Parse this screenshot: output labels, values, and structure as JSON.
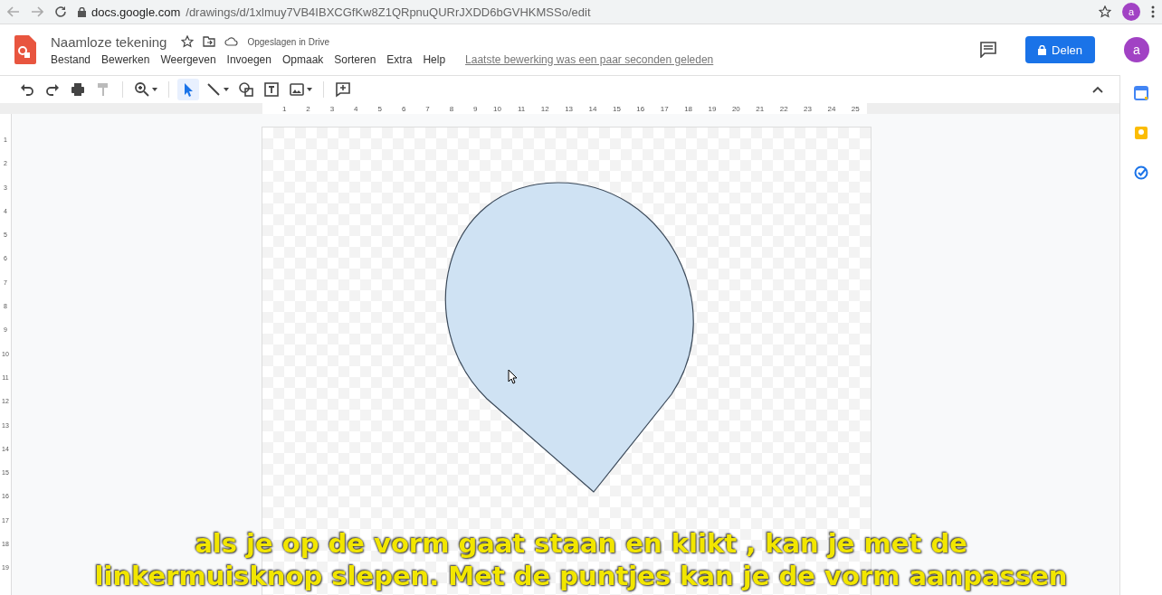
{
  "browser": {
    "url_host": "docs.google.com",
    "url_path": "/drawings/d/1xlmuy7VB4IBXCGfKw8Z1QRpnuQURrJXDD6bGVHKMSSo/edit",
    "avatar": "a"
  },
  "app": {
    "title": "Naamloze tekening",
    "save_status": "Opgeslagen in Drive",
    "menu": [
      "Bestand",
      "Bewerken",
      "Weergeven",
      "Invoegen",
      "Opmaak",
      "Sorteren",
      "Extra",
      "Help"
    ],
    "last_edit": "Laatste bewerking was een paar seconden geleden",
    "share_button": "Delen",
    "avatar": "a"
  },
  "toolbar": {
    "tools": [
      {
        "kind": "undo",
        "selected": false
      },
      {
        "kind": "redo",
        "selected": false
      },
      {
        "kind": "print",
        "selected": false
      },
      {
        "kind": "paint",
        "selected": false
      },
      {
        "kind": "zoom",
        "selected": false
      },
      {
        "kind": "select",
        "selected": true
      },
      {
        "kind": "line",
        "selected": false
      },
      {
        "kind": "shape",
        "selected": false
      },
      {
        "kind": "textbox",
        "selected": false
      },
      {
        "kind": "image",
        "selected": false
      },
      {
        "kind": "comment",
        "selected": false
      }
    ]
  },
  "rulers": {
    "horizontal": [
      "1",
      "2",
      "3",
      "4",
      "5",
      "6",
      "7",
      "8",
      "9",
      "10",
      "11",
      "12",
      "13",
      "14",
      "15",
      "16",
      "17",
      "18",
      "19",
      "20",
      "21",
      "22",
      "23",
      "24",
      "25"
    ],
    "vertical": [
      "1",
      "2",
      "3",
      "4",
      "5",
      "6",
      "7",
      "8",
      "9",
      "10",
      "11",
      "12",
      "13",
      "14",
      "15",
      "16",
      "17",
      "18",
      "19"
    ]
  },
  "subtitles": [
    "als je op de vorm gaat staan en klikt , kan je met de",
    "linkermuisknop slepen. Met de puntjes kan je de vorm aanpassen"
  ]
}
